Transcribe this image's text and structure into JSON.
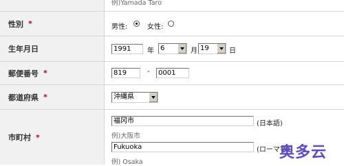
{
  "name_hint": "例)Yamada Taro",
  "gender": {
    "label": "性別",
    "required_mark": "*",
    "options": [
      {
        "label": "男性:",
        "selected": true
      },
      {
        "label": "女性:",
        "selected": false
      }
    ]
  },
  "birthdate": {
    "label": "生年月日",
    "year": "1991",
    "year_unit": "年",
    "month": "6",
    "month_unit": "月",
    "day": "19",
    "day_unit": "日"
  },
  "postal": {
    "label": "郵便番号",
    "required_mark": "*",
    "part1": "819",
    "separator": "-",
    "part2": "0001"
  },
  "prefecture": {
    "label": "都道府県",
    "required_mark": "*",
    "selected": "沖縄県"
  },
  "city": {
    "label": "市町村",
    "required_mark": "*",
    "jp_value": "福冈市",
    "jp_note": "(日本語)",
    "jp_hint": "例)大阪市",
    "roman_value": "Fukuoka",
    "roman_note": "(ローマ字)",
    "roman_hint": "例) Osaka"
  },
  "watermark": "奥多云"
}
